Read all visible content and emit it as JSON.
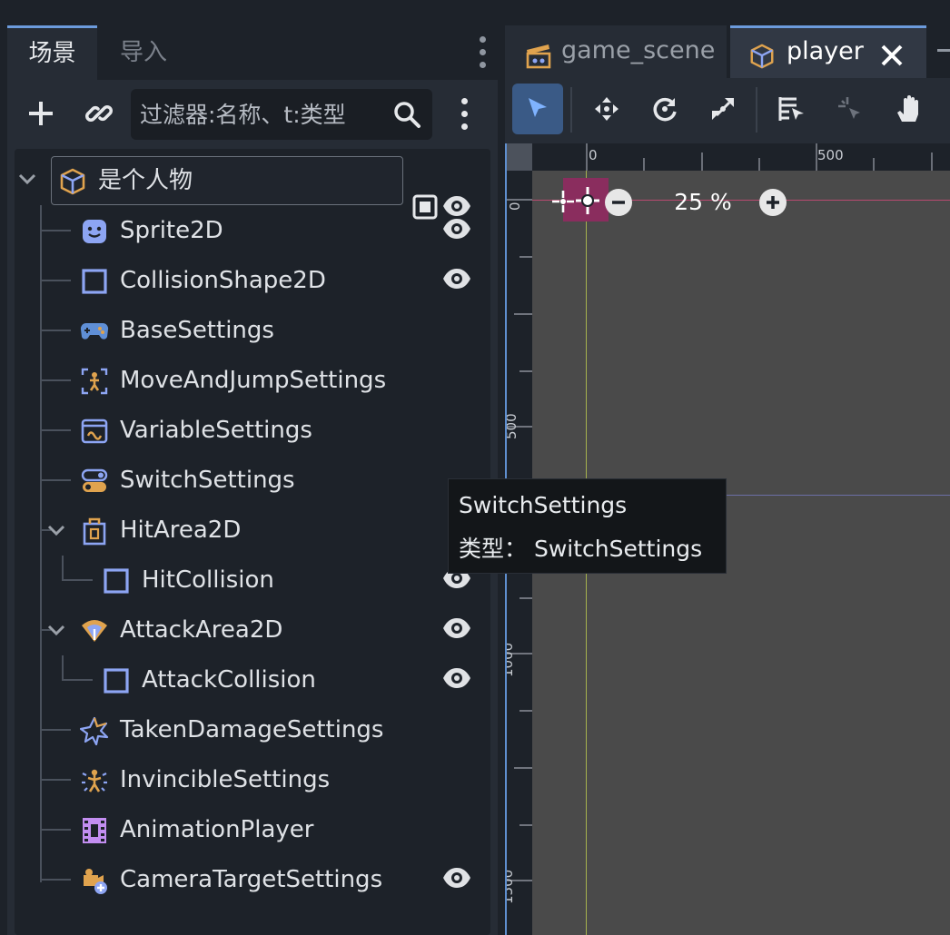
{
  "scene_dock": {
    "tabs": [
      {
        "label": "场景",
        "active": true
      },
      {
        "label": "导入",
        "active": false
      }
    ],
    "filter": {
      "placeholder": "过滤器:名称、t:类型",
      "value": ""
    },
    "tree": [
      {
        "label": "是个人物",
        "icon": "node3d-cube-icon",
        "root": true,
        "expanded": true,
        "visible_toggle": true
      },
      {
        "label": "Sprite2D",
        "icon": "sprite2d-icon",
        "visible_toggle": true
      },
      {
        "label": "CollisionShape2D",
        "icon": "collision-shape-icon",
        "visible_toggle": true
      },
      {
        "label": "BaseSettings",
        "icon": "gamepad-icon"
      },
      {
        "label": "MoveAndJumpSettings",
        "icon": "move-jump-icon"
      },
      {
        "label": "VariableSettings",
        "icon": "variable-icon"
      },
      {
        "label": "SwitchSettings",
        "icon": "switch-icon"
      },
      {
        "label": "HitArea2D",
        "icon": "hit-area-icon",
        "expanded": true
      },
      {
        "label": "HitCollision",
        "icon": "collision-shape-icon",
        "child": true,
        "visible_toggle": true
      },
      {
        "label": "AttackArea2D",
        "icon": "attack-area-icon",
        "expanded": true,
        "visible_toggle": true
      },
      {
        "label": "AttackCollision",
        "icon": "collision-shape-icon",
        "child": true,
        "visible_toggle": true
      },
      {
        "label": "TakenDamageSettings",
        "icon": "damage-star-icon"
      },
      {
        "label": "InvincibleSettings",
        "icon": "invincible-icon"
      },
      {
        "label": "AnimationPlayer",
        "icon": "animation-player-icon"
      },
      {
        "label": "CameraTargetSettings",
        "icon": "camera-target-icon",
        "visible_toggle": true
      }
    ]
  },
  "editor": {
    "tabs": [
      {
        "label": "game_scene",
        "active": false
      },
      {
        "label": "player",
        "active": true
      }
    ],
    "ruler": {
      "top_ticks": [
        "0",
        "500"
      ],
      "left_ticks": [
        "0",
        "500",
        "1000",
        "1500"
      ]
    },
    "zoom": "25 %"
  },
  "tooltip": {
    "title": "SwitchSettings",
    "type_line": "类型： SwitchSettings"
  },
  "colors": {
    "accent": "#6c9bdc",
    "icon_blue": "#8da5f3",
    "icon_orange": "#e0a34e",
    "eye": "#e0e2e5"
  }
}
